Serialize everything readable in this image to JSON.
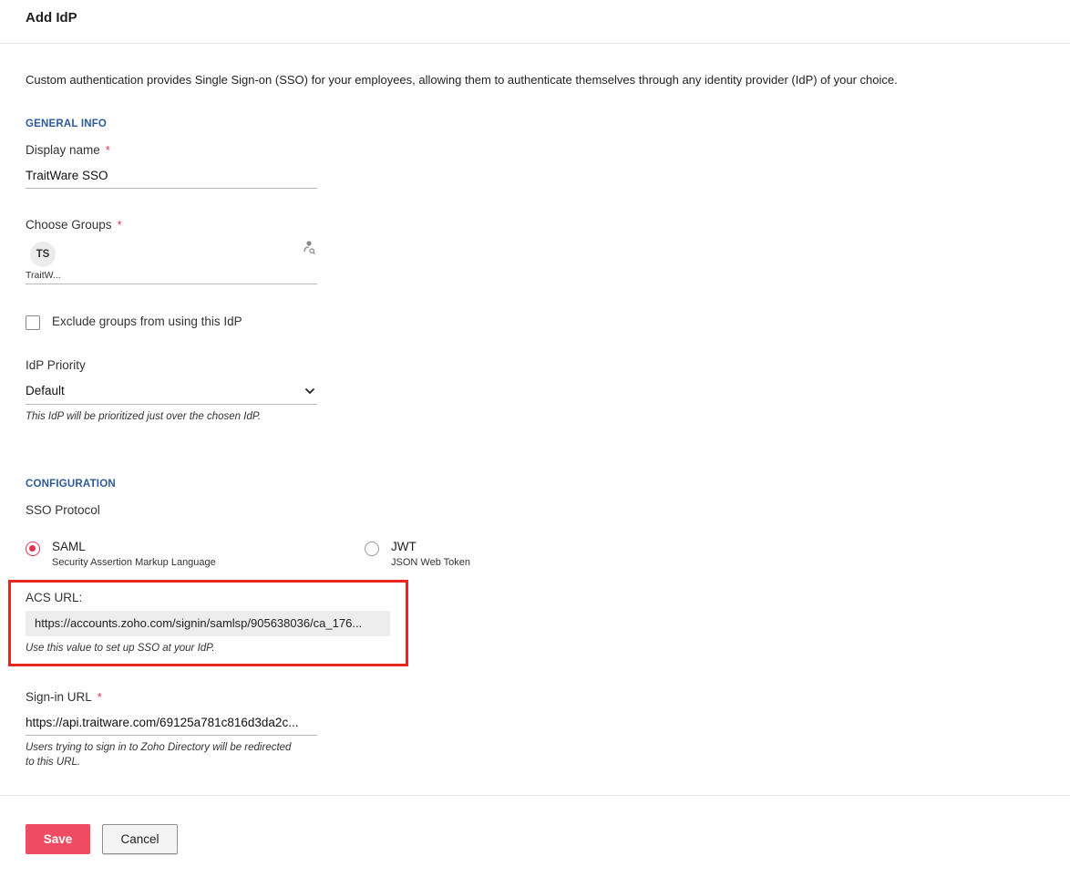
{
  "header": {
    "title": "Add IdP"
  },
  "intro": "Custom authentication provides Single Sign-on (SSO) for your employees, allowing them to authenticate themselves through any identity provider (IdP) of your choice.",
  "general_info": {
    "heading": "GENERAL INFO",
    "display_name": {
      "label": "Display name",
      "required_mark": "*",
      "value": "TraitWare SSO"
    },
    "choose_groups": {
      "label": "Choose Groups",
      "required_mark": "*",
      "chips": [
        {
          "initials": "TS",
          "name": "TraitW..."
        }
      ],
      "icon": "user-search-icon"
    },
    "exclude_groups": {
      "label": "Exclude groups from using this IdP",
      "checked": false
    },
    "priority": {
      "label": "IdP Priority",
      "selected": "Default",
      "hint": "This IdP will be prioritized just over the chosen IdP."
    }
  },
  "configuration": {
    "heading": "CONFIGURATION",
    "protocol_label": "SSO Protocol",
    "options": [
      {
        "title": "SAML",
        "subtitle": "Security Assertion Markup Language",
        "selected": true
      },
      {
        "title": "JWT",
        "subtitle": "JSON Web Token",
        "selected": false
      }
    ],
    "acs": {
      "label": "ACS URL:",
      "value": "https://accounts.zoho.com/signin/samlsp/905638036/ca_176...",
      "hint": "Use this value to set up SSO at your IdP."
    },
    "signin": {
      "label": "Sign-in URL",
      "required_mark": "*",
      "value": "https://api.traitware.com/69125a781c816d3da2c...",
      "hint_line1": "Users trying to sign in to Zoho Directory will be redirected",
      "hint_line2": "to this URL."
    }
  },
  "footer": {
    "save_label": "Save",
    "cancel_label": "Cancel"
  },
  "colors": {
    "accent": "#ef4b63",
    "section_heading": "#2d5a9b",
    "highlight": "#e8261f",
    "required": "#e0344f"
  }
}
